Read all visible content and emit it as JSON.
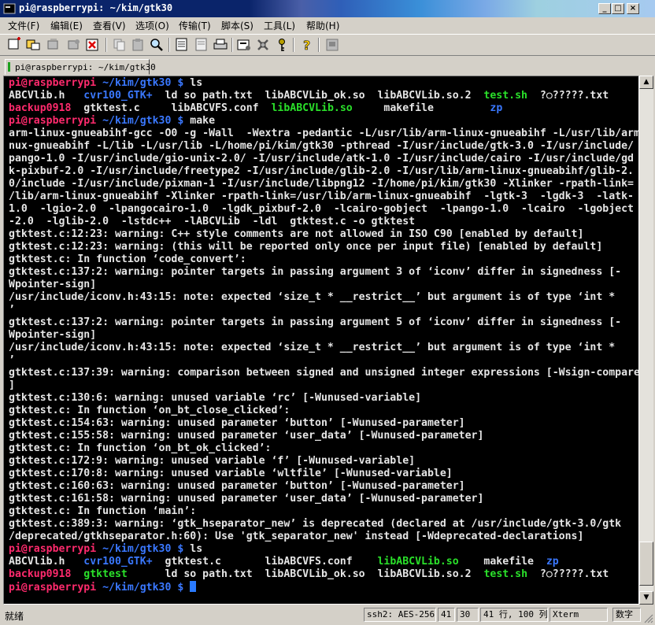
{
  "window": {
    "title": "pi@raspberrypi: ~/kim/gtk30",
    "controls": [
      "_",
      "□",
      "×"
    ]
  },
  "menu": [
    "文件(F)",
    "编辑(E)",
    "查看(V)",
    "选项(O)",
    "传输(T)",
    "脚本(S)",
    "工具(L)",
    "帮助(H)"
  ],
  "toolbar": {
    "icons": [
      "new-session-icon",
      "connect-icon",
      "reconnect-icon",
      "disconnect-icon",
      "close-session-icon",
      "copy-icon",
      "paste-icon",
      "find-icon",
      "print-setup-icon",
      "print-preview-icon",
      "print-icon",
      "session-options-icon",
      "global-options-icon",
      "key-map-icon",
      "help-icon",
      "about-icon"
    ]
  },
  "tab": {
    "label": "pi@raspberrypi: ~/kim/gtk30"
  },
  "terminal": {
    "lines": [
      [
        {
          "t": "pi@raspberrypi",
          "c": "prompt"
        },
        {
          "t": " ~/kim/gtk30 $",
          "c": "path"
        },
        {
          "t": " ls",
          "c": "cmd"
        }
      ],
      [
        {
          "t": "ABCVlib.h   ",
          "c": "norm"
        },
        {
          "t": "cvr100_GTK+",
          "c": "blue"
        },
        {
          "t": "  ld so path.txt  libABCVLib_ok.so  libABCVLib.so.2  ",
          "c": "norm"
        },
        {
          "t": "test.sh",
          "c": "green"
        },
        {
          "t": "  ?○?????.txt",
          "c": "norm"
        }
      ],
      [
        {
          "t": "backup0918",
          "c": "red"
        },
        {
          "t": "  gtktest.c     libABCVFS.conf  ",
          "c": "norm"
        },
        {
          "t": "libABCVLib.so",
          "c": "green"
        },
        {
          "t": "     makefile         ",
          "c": "norm"
        },
        {
          "t": "zp",
          "c": "blue"
        }
      ],
      [
        {
          "t": "pi@raspberrypi",
          "c": "prompt"
        },
        {
          "t": " ~/kim/gtk30 $",
          "c": "path"
        },
        {
          "t": " make",
          "c": "cmd"
        }
      ],
      [
        {
          "t": "arm-linux-gnueabihf-gcc -O0 -g -Wall  -Wextra -pedantic -L/usr/lib/arm-linux-gnueabihf -L/usr/lib/arm-li",
          "c": "norm"
        }
      ],
      [
        {
          "t": "nux-gnueabihf -L/lib -L/usr/lib -L/home/pi/kim/gtk30 -pthread -I/usr/include/gtk-3.0 -I/usr/include/",
          "c": "norm"
        }
      ],
      [
        {
          "t": "pango-1.0 -I/usr/include/gio-unix-2.0/ -I/usr/include/atk-1.0 -I/usr/include/cairo -I/usr/include/gd",
          "c": "norm"
        }
      ],
      [
        {
          "t": "k-pixbuf-2.0 -I/usr/include/freetype2 -I/usr/include/glib-2.0 -I/usr/lib/arm-linux-gnueabihf/glib-2.",
          "c": "norm"
        }
      ],
      [
        {
          "t": "0/include -I/usr/include/pixman-1 -I/usr/include/libpng12 -I/home/pi/kim/gtk30 -Xlinker -rpath-link=",
          "c": "norm"
        }
      ],
      [
        {
          "t": "/lib/arm-linux-gnueabihf -Xlinker -rpath-link=/usr/lib/arm-linux-gnueabihf  -lgtk-3  -lgdk-3  -latk-",
          "c": "norm"
        }
      ],
      [
        {
          "t": "1.0  -lgio-2.0  -lpangocairo-1.0  -lgdk_pixbuf-2.0  -lcairo-gobject  -lpango-1.0  -lcairo  -lgobject",
          "c": "norm"
        }
      ],
      [
        {
          "t": "-2.0  -lglib-2.0  -lstdc++  -lABCVLib  -ldl  gtktest.c -o gtktest",
          "c": "norm"
        }
      ],
      [
        {
          "t": "gtktest.c:12:23: warning: C++ style comments are not allowed in ISO C90 [enabled by default]",
          "c": "norm"
        }
      ],
      [
        {
          "t": "gtktest.c:12:23: warning: (this will be reported only once per input file) [enabled by default]",
          "c": "norm"
        }
      ],
      [
        {
          "t": "gtktest.c: In function ‘code_convert’:",
          "c": "norm"
        }
      ],
      [
        {
          "t": "gtktest.c:137:2: warning: pointer targets in passing argument 3 of ‘iconv’ differ in signedness [-",
          "c": "norm"
        }
      ],
      [
        {
          "t": "Wpointer-sign]",
          "c": "norm"
        }
      ],
      [
        {
          "t": "/usr/include/iconv.h:43:15: note: expected ‘size_t * __restrict__’ but argument is of type ‘int *",
          "c": "norm"
        }
      ],
      [
        {
          "t": "’",
          "c": "norm"
        }
      ],
      [
        {
          "t": "gtktest.c:137:2: warning: pointer targets in passing argument 5 of ‘iconv’ differ in signedness [-",
          "c": "norm"
        }
      ],
      [
        {
          "t": "Wpointer-sign]",
          "c": "norm"
        }
      ],
      [
        {
          "t": "/usr/include/iconv.h:43:15: note: expected ‘size_t * __restrict__’ but argument is of type ‘int *",
          "c": "norm"
        }
      ],
      [
        {
          "t": "’",
          "c": "norm"
        }
      ],
      [
        {
          "t": "gtktest.c:137:39: warning: comparison between signed and unsigned integer expressions [-Wsign-compare",
          "c": "norm"
        }
      ],
      [
        {
          "t": "]",
          "c": "norm"
        }
      ],
      [
        {
          "t": "gtktest.c:130:6: warning: unused variable ‘rc’ [-Wunused-variable]",
          "c": "norm"
        }
      ],
      [
        {
          "t": "gtktest.c: In function ‘on_bt_close_clicked’:",
          "c": "norm"
        }
      ],
      [
        {
          "t": "gtktest.c:154:63: warning: unused parameter ‘button’ [-Wunused-parameter]",
          "c": "norm"
        }
      ],
      [
        {
          "t": "gtktest.c:155:58: warning: unused parameter ‘user_data’ [-Wunused-parameter]",
          "c": "norm"
        }
      ],
      [
        {
          "t": "gtktest.c: In function ‘on_bt_ok_clicked’:",
          "c": "norm"
        }
      ],
      [
        {
          "t": "gtktest.c:172:9: warning: unused variable ‘f’ [-Wunused-variable]",
          "c": "norm"
        }
      ],
      [
        {
          "t": "gtktest.c:170:8: warning: unused variable ‘wltfile’ [-Wunused-variable]",
          "c": "norm"
        }
      ],
      [
        {
          "t": "gtktest.c:160:63: warning: unused parameter ‘button’ [-Wunused-parameter]",
          "c": "norm"
        }
      ],
      [
        {
          "t": "gtktest.c:161:58: warning: unused parameter ‘user_data’ [-Wunused-parameter]",
          "c": "norm"
        }
      ],
      [
        {
          "t": "gtktest.c: In function ‘main’:",
          "c": "norm"
        }
      ],
      [
        {
          "t": "gtktest.c:389:3: warning: ‘gtk_hseparator_new’ is deprecated (declared at /usr/include/gtk-3.0/gtk",
          "c": "norm"
        }
      ],
      [
        {
          "t": "/deprecated/gtkhseparator.h:60): Use 'gtk_separator_new' instead [-Wdeprecated-declarations]",
          "c": "norm"
        }
      ],
      [
        {
          "t": "pi@raspberrypi",
          "c": "prompt"
        },
        {
          "t": " ~/kim/gtk30 $",
          "c": "path"
        },
        {
          "t": " ls",
          "c": "cmd"
        }
      ],
      [
        {
          "t": "ABCVlib.h   ",
          "c": "norm"
        },
        {
          "t": "cvr100_GTK+",
          "c": "blue"
        },
        {
          "t": "  gtktest.c       libABCVFS.conf    ",
          "c": "norm"
        },
        {
          "t": "libABCVLib.so",
          "c": "green"
        },
        {
          "t": "    makefile  ",
          "c": "norm"
        },
        {
          "t": "zp",
          "c": "blue"
        }
      ],
      [
        {
          "t": "backup0918",
          "c": "red"
        },
        {
          "t": "  ",
          "c": "norm"
        },
        {
          "t": "gtktest",
          "c": "green"
        },
        {
          "t": "      ld so path.txt  libABCVLib_ok.so  libABCVLib.so.2  ",
          "c": "norm"
        },
        {
          "t": "test.sh",
          "c": "green"
        },
        {
          "t": "  ?○?????.txt",
          "c": "norm"
        }
      ],
      [
        {
          "t": "pi@raspberrypi",
          "c": "prompt"
        },
        {
          "t": " ~/kim/gtk30 $",
          "c": "path"
        },
        {
          "t": " ",
          "c": "cmd"
        }
      ]
    ]
  },
  "status": {
    "ready": "就绪",
    "protocol": "ssh2: AES-256",
    "row": "41",
    "col": "30",
    "size": "41 行, 100 列",
    "terminal_type": "Xterm",
    "numlock": "数字"
  }
}
